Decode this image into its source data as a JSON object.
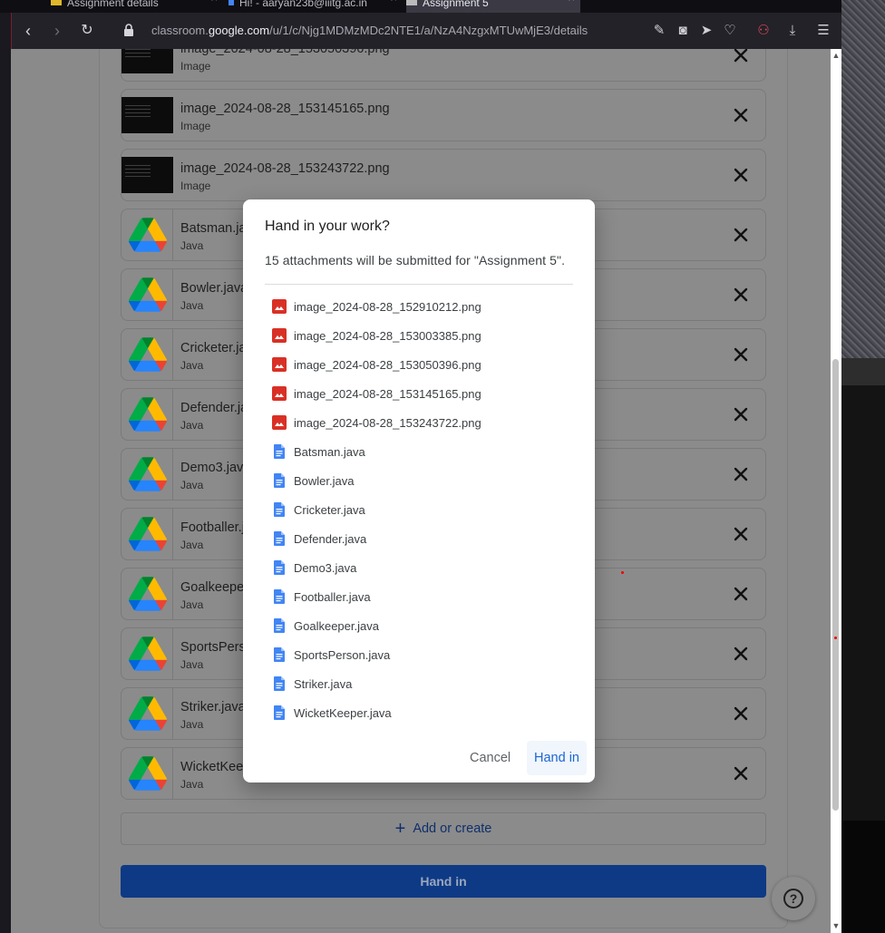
{
  "browser": {
    "tabs": [
      {
        "label": "Assignment details"
      },
      {
        "label": "Hi! - aaryan23b@iiitg.ac.in"
      },
      {
        "label": "Assignment 5"
      }
    ],
    "url_prefix": "classroom.",
    "url_domain": "google.com",
    "url_path": "/u/1/c/Njg1MDMzMDc2NTE1/a/NzA4NzgxMTUwMjE3/details"
  },
  "attachments": [
    {
      "name": "image_2024-08-28_153050396.png",
      "type": "Image",
      "kind": "image"
    },
    {
      "name": "image_2024-08-28_153145165.png",
      "type": "Image",
      "kind": "image"
    },
    {
      "name": "image_2024-08-28_153243722.png",
      "type": "Image",
      "kind": "image"
    },
    {
      "name": "Batsman.java",
      "type": "Java",
      "kind": "drive"
    },
    {
      "name": "Bowler.java",
      "type": "Java",
      "kind": "drive"
    },
    {
      "name": "Cricketer.java",
      "type": "Java",
      "kind": "drive"
    },
    {
      "name": "Defender.java",
      "type": "Java",
      "kind": "drive"
    },
    {
      "name": "Demo3.java",
      "type": "Java",
      "kind": "drive"
    },
    {
      "name": "Footballer.java",
      "type": "Java",
      "kind": "drive"
    },
    {
      "name": "Goalkeeper.java",
      "type": "Java",
      "kind": "drive"
    },
    {
      "name": "SportsPerson.java",
      "type": "Java",
      "kind": "drive"
    },
    {
      "name": "Striker.java",
      "type": "Java",
      "kind": "drive"
    },
    {
      "name": "WicketKeeper.java",
      "type": "Java",
      "kind": "drive"
    }
  ],
  "add_or_create_label": "Add or create",
  "hand_in_label": "Hand in",
  "help_icon": "?",
  "dialog": {
    "title": "Hand in your work?",
    "subtitle": "15 attachments will be submitted for \"Assignment 5\".",
    "files": [
      {
        "name": "image_2024-08-28_152910212.png",
        "kind": "image"
      },
      {
        "name": "image_2024-08-28_153003385.png",
        "kind": "image"
      },
      {
        "name": "image_2024-08-28_153050396.png",
        "kind": "image"
      },
      {
        "name": "image_2024-08-28_153145165.png",
        "kind": "image"
      },
      {
        "name": "image_2024-08-28_153243722.png",
        "kind": "image"
      },
      {
        "name": "Batsman.java",
        "kind": "doc"
      },
      {
        "name": "Bowler.java",
        "kind": "doc"
      },
      {
        "name": "Cricketer.java",
        "kind": "doc"
      },
      {
        "name": "Defender.java",
        "kind": "doc"
      },
      {
        "name": "Demo3.java",
        "kind": "doc"
      },
      {
        "name": "Footballer.java",
        "kind": "doc"
      },
      {
        "name": "Goalkeeper.java",
        "kind": "doc"
      },
      {
        "name": "SportsPerson.java",
        "kind": "doc"
      },
      {
        "name": "Striker.java",
        "kind": "doc"
      },
      {
        "name": "WicketKeeper.java",
        "kind": "doc"
      }
    ],
    "cancel_label": "Cancel",
    "hand_in_label": "Hand in"
  },
  "colors": {
    "accent_blue": "#1967d2",
    "image_red": "#d93025",
    "doc_blue": "#4285f4"
  }
}
